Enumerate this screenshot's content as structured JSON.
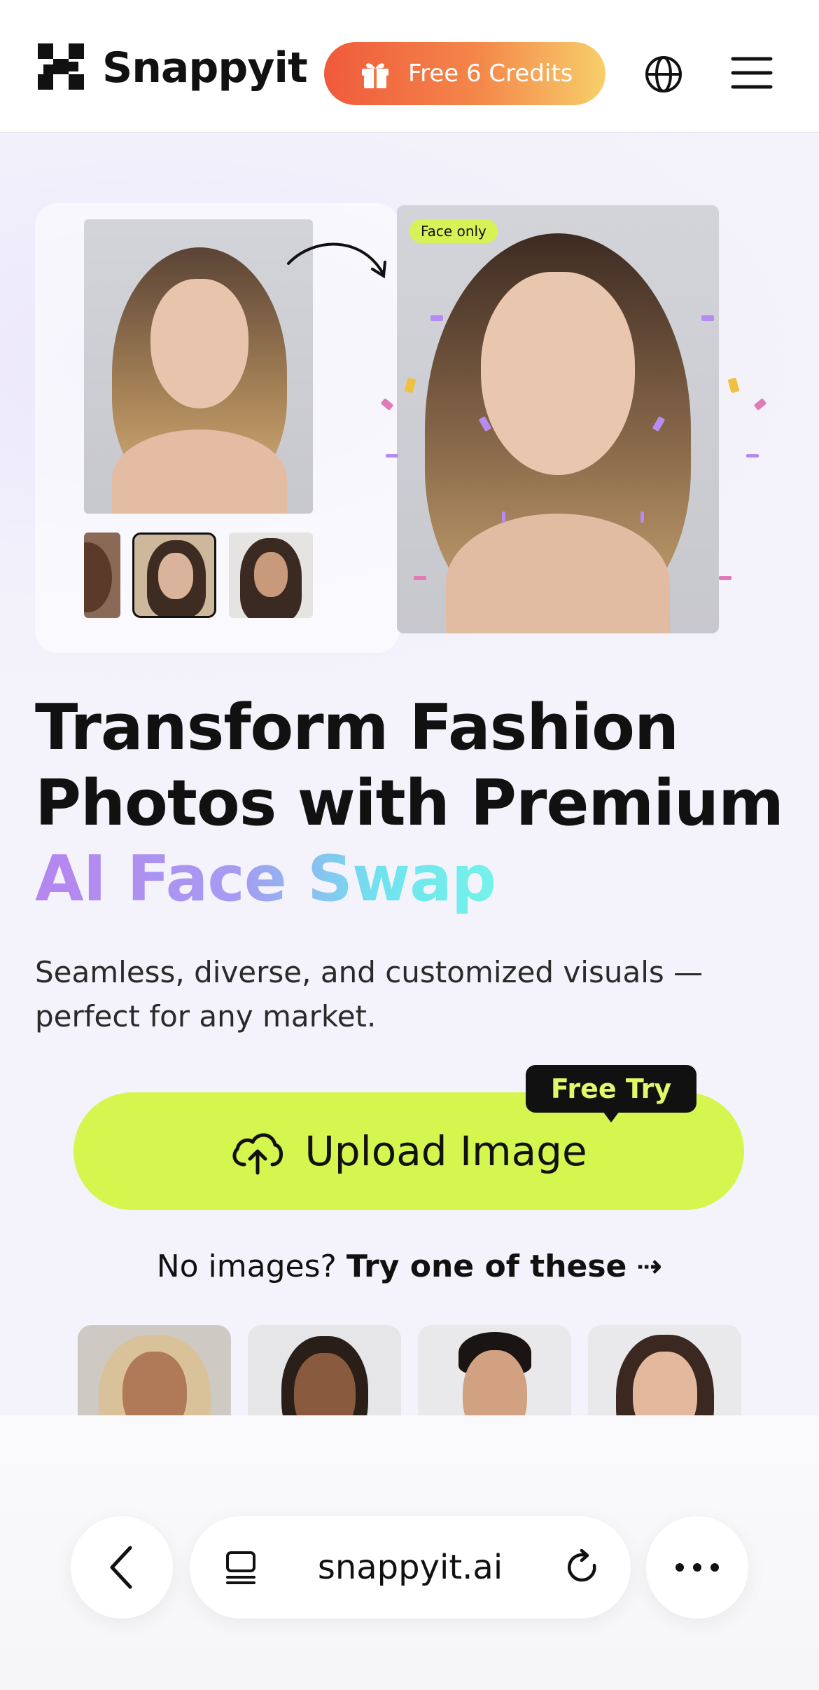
{
  "header": {
    "brand": "Snappyit",
    "credits_label": "Free 6 Credits",
    "icons": [
      "logo-icon",
      "gift-icon",
      "globe-icon",
      "menu-icon"
    ]
  },
  "hero": {
    "badge": "Face only",
    "headline_line1": "Transform Fashion",
    "headline_line2": "Photos with Premium",
    "headline_accent": "AI Face Swap",
    "subtext": "Seamless, diverse, and customized visuals — perfect for any market."
  },
  "upload": {
    "label": "Upload Image",
    "tag": "Free Try",
    "icon": "cloud-upload-icon"
  },
  "samples": {
    "prompt": "No images?",
    "prompt_bold": "Try one of these",
    "arrow": "⇢"
  },
  "browser": {
    "url": "snappyit.ai",
    "icons": [
      "back-icon",
      "tabs-icon",
      "reload-icon",
      "more-icon"
    ]
  },
  "colors": {
    "accent_lime": "#d5f54f",
    "credits_start": "#ef5a3c",
    "credits_end": "#f7cf6a",
    "text": "#111111",
    "background": "#f4f3fb"
  }
}
